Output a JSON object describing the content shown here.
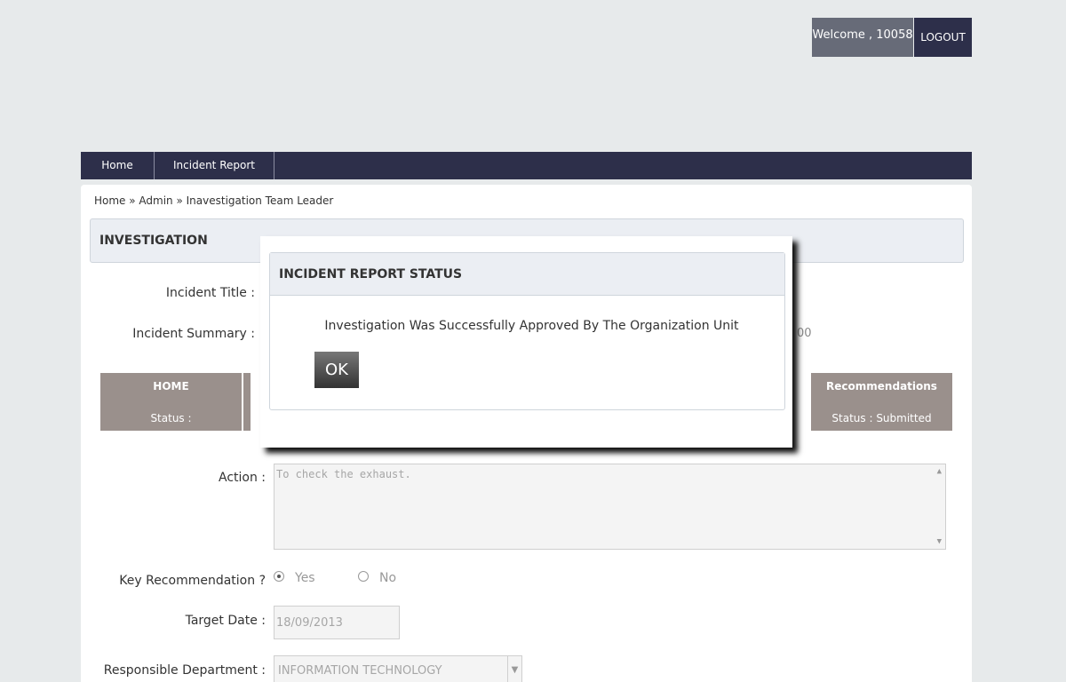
{
  "header": {
    "welcome_text": "Welcome , 10058",
    "logout_label": "LOGOUT"
  },
  "nav": {
    "items": [
      {
        "label": "Home"
      },
      {
        "label": "Incident Report"
      }
    ]
  },
  "breadcrumb": "Home » Admin » Inavestigation Team Leader",
  "panel": {
    "title": "INVESTIGATION"
  },
  "form": {
    "incident_title_label": "Incident Title :",
    "incident_summary_label": "Incident Summary :",
    "summary_stray": "00",
    "tabs": [
      {
        "title": "HOME",
        "status": "Status :"
      },
      {
        "title": "Recommendations",
        "status": "Status : Submitted"
      }
    ],
    "action_label": "Action :",
    "action_value": "To check the exhaust.",
    "key_recommendation_label": "Key Recommendation ?",
    "yes_label": "Yes",
    "no_label": "No",
    "key_recommendation_selected": "Yes",
    "target_date_label": "Target Date :",
    "target_date_value": "18/09/2013",
    "department_label": "Responsible Department :",
    "department_value": "INFORMATION TECHNOLOGY"
  },
  "modal": {
    "title": "INCIDENT REPORT STATUS",
    "message": "Investigation Was Successfully Approved By The Organization Unit",
    "ok_label": "OK"
  },
  "icons": {
    "scroll_up": "▲",
    "scroll_down": "▼",
    "dropdown": "▼"
  }
}
